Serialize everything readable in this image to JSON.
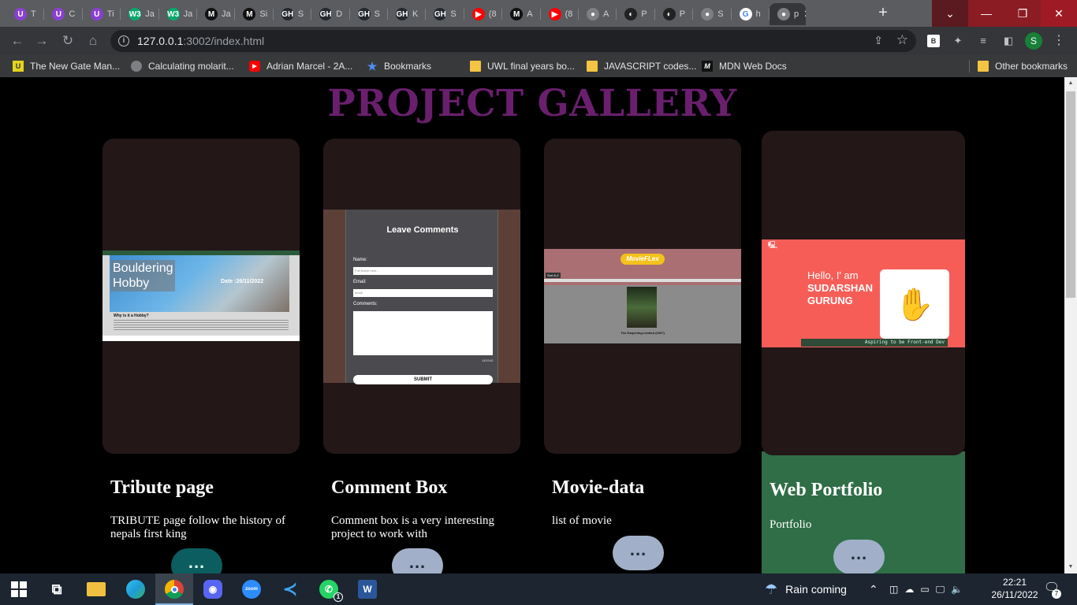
{
  "browser": {
    "tabs": [
      {
        "label": "T",
        "icon": "U",
        "color": "#8b3fd1"
      },
      {
        "label": "C",
        "icon": "U",
        "color": "#8b3fd1"
      },
      {
        "label": "Ti",
        "icon": "U",
        "color": "#8b3fd1"
      },
      {
        "label": "Ja",
        "icon": "W3",
        "color": "#04aa6d"
      },
      {
        "label": "Ja",
        "icon": "W3",
        "color": "#04aa6d"
      },
      {
        "label": "Ja",
        "icon": "M",
        "color": "#111111"
      },
      {
        "label": "Si",
        "icon": "M",
        "color": "#111111"
      },
      {
        "label": "S",
        "icon": "GH",
        "color": "#24292f"
      },
      {
        "label": "D",
        "icon": "GH",
        "color": "#24292f"
      },
      {
        "label": "S",
        "icon": "GH",
        "color": "#24292f"
      },
      {
        "label": "K",
        "icon": "GH",
        "color": "#24292f"
      },
      {
        "label": "S",
        "icon": "GH",
        "color": "#24292f"
      },
      {
        "label": "(8",
        "icon": "▶",
        "color": "#ff0000"
      },
      {
        "label": "A",
        "icon": "M",
        "color": "#111111"
      },
      {
        "label": "(8",
        "icon": "▶",
        "color": "#ff0000"
      },
      {
        "label": "A",
        "icon": "●",
        "color": "#7d7f83"
      },
      {
        "label": "P",
        "icon": "◐",
        "color": "#222222"
      },
      {
        "label": "P",
        "icon": "◐",
        "color": "#222222"
      },
      {
        "label": "S",
        "icon": "●",
        "color": "#7d7f83"
      },
      {
        "label": "h",
        "icon": "G",
        "color": "#ffffff"
      },
      {
        "label": "p",
        "icon": "●",
        "color": "#7d7f83"
      }
    ],
    "active_tab_close": "✕",
    "new_tab": "+",
    "url_host": "127.0.0.1",
    "url_path": ":3002/index.html",
    "profile_initial": "S",
    "bookmarks": [
      "The New Gate Man...",
      "Calculating molarit...",
      "Adrian Marcel - 2A...",
      "Bookmarks",
      "UWL final years bo...",
      "JAVASCRIPT codes...",
      "MDN Web Docs"
    ],
    "other_bookmarks": "Other bookmarks"
  },
  "page": {
    "title": "PROJECT GALLERY",
    "cards": [
      {
        "title": "Tribute page",
        "description": "TRIBUTE page follow the history of nepals first king",
        "button": "..."
      },
      {
        "title": "Comment Box",
        "description": "Comment box is a very interesting project to work with",
        "button": "..."
      },
      {
        "title": "Movie-data",
        "description": "list of movie",
        "button": "..."
      },
      {
        "title": "Web Portfolio",
        "description": "Portfolio",
        "button": "..."
      }
    ],
    "shot1": {
      "hero_title": "Bouldering Hobby",
      "date": "Date :26/11/2022",
      "why": "Why is it a Hobby?"
    },
    "shot2": {
      "heading": "Leave Comments",
      "name_label": "Name:",
      "name_placeholder": "Full Name here...",
      "email_label": "Email:",
      "email_placeholder": "email",
      "comments_label": "Comments:",
      "count": "140/140",
      "submit": "SUBMIT"
    },
    "shot3": {
      "logo": "MovieFLex",
      "sort": "Sort A-Z",
      "movie": "The Darjeeling Limited (2007)"
    },
    "shot4": {
      "hello": "Hello, I' am",
      "name1": "SUDARSHAN",
      "name2": "GURUNG",
      "tagline": "Aspiring to be Front-end Dev"
    }
  },
  "taskbar": {
    "weather": "Rain coming",
    "time": "22:21",
    "date": "26/11/2022",
    "notifications": "7",
    "whatsapp_badge": "1"
  }
}
